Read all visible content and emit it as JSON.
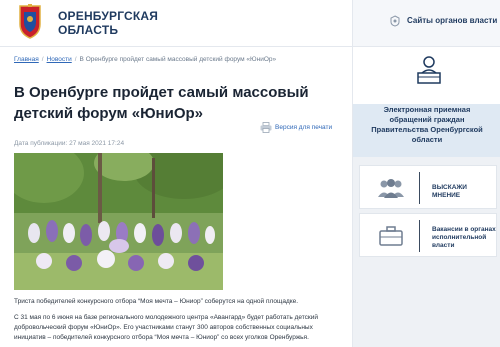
{
  "header": {
    "region_title": "ОРЕНБУРГСКАЯ ОБЛАСТЬ",
    "gov_link_label": "Сайты органов власти",
    "brand_color": "#1f3a5f"
  },
  "breadcrumb": {
    "items": [
      "Главная",
      "Новости",
      "В Оренбурге пройдет самый массовый детский форум «ЮниОр»"
    ]
  },
  "article": {
    "title": "В Оренбурге пройдет самый массовый детский форум «ЮниОр»",
    "print_label": "Версия для печати",
    "publication_date": "Дата публикации: 27 мая 2021 17:24",
    "lead": "Триста победителей конкурсного отбора “Моя мечта – Юниор” соберутся на одной площадке.",
    "body": "С 31 мая по 6 июня на базе регионального молодежного центра «Авангард» будет работать детский добровольческий форум «ЮниОр». Его участниками станут 300 авторов собственных социальных инициатив – победителей конкурсного отбора “Моя мечта – Юниор” со всех уголков Оренбуржья."
  },
  "sidebar": {
    "reception_label": "Электронная приемная обращений граждан Правительства Оренбургской области",
    "opinion_label": "ВЫСКАЖИ МНЕНИЕ",
    "vacancies_label": "Вакансии в органах исполнительной власти",
    "icons": [
      "reception-desk-icon",
      "people-group-icon",
      "briefcase-icon"
    ]
  }
}
